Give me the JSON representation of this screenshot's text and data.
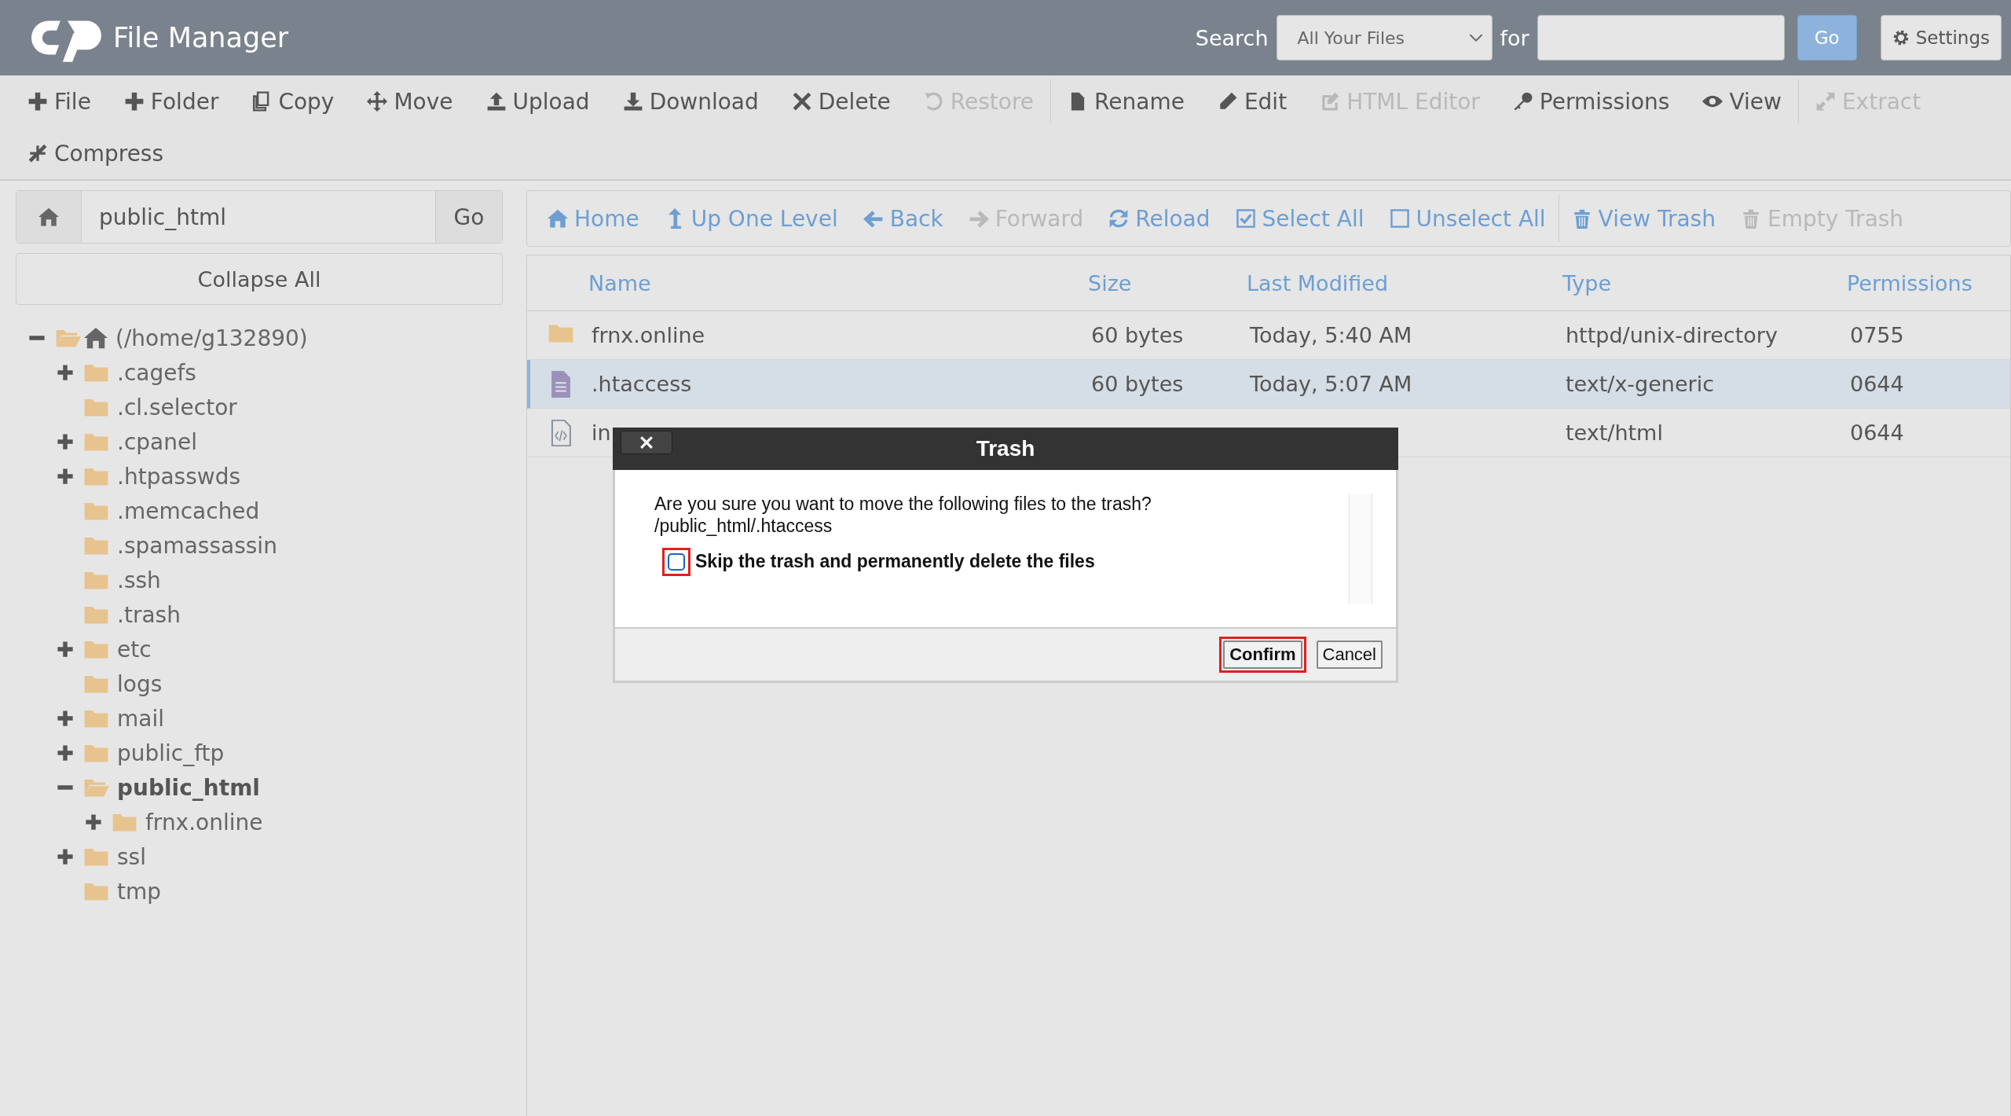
{
  "header": {
    "title": "File Manager",
    "search_label": "Search",
    "search_scope": "All Your Files",
    "for_label": "for",
    "go": "Go",
    "settings": "Settings"
  },
  "toolbar": [
    {
      "label": "File",
      "disabled": false
    },
    {
      "label": "Folder",
      "disabled": false
    },
    {
      "label": "Copy",
      "disabled": false
    },
    {
      "label": "Move",
      "disabled": false
    },
    {
      "label": "Upload",
      "disabled": false
    },
    {
      "label": "Download",
      "disabled": false
    },
    {
      "label": "Delete",
      "disabled": false
    },
    {
      "label": "Restore",
      "disabled": true
    },
    {
      "label": "Rename",
      "disabled": false
    },
    {
      "label": "Edit",
      "disabled": false
    },
    {
      "label": "HTML Editor",
      "disabled": true
    },
    {
      "label": "Permissions",
      "disabled": false
    },
    {
      "label": "View",
      "disabled": false
    },
    {
      "label": "Extract",
      "disabled": true
    },
    {
      "label": "Compress",
      "disabled": false
    }
  ],
  "path_bar": {
    "value": "public_html",
    "go": "Go"
  },
  "collapse_all": "Collapse All",
  "tree": [
    {
      "label": "(/home/g132890)",
      "kind": "root",
      "expanded": true,
      "selected": false,
      "children": [
        {
          "label": ".cagefs",
          "kind": "toggle",
          "expanded": false,
          "selected": false
        },
        {
          "label": ".cl.selector",
          "kind": "leaf",
          "selected": false
        },
        {
          "label": ".cpanel",
          "kind": "toggle",
          "expanded": false,
          "selected": false
        },
        {
          "label": ".htpasswds",
          "kind": "toggle",
          "expanded": false,
          "selected": false
        },
        {
          "label": ".memcached",
          "kind": "leaf",
          "selected": false
        },
        {
          "label": ".spamassassin",
          "kind": "leaf",
          "selected": false
        },
        {
          "label": ".ssh",
          "kind": "leaf",
          "selected": false
        },
        {
          "label": ".trash",
          "kind": "leaf",
          "selected": false
        },
        {
          "label": "etc",
          "kind": "toggle",
          "expanded": false,
          "selected": false
        },
        {
          "label": "logs",
          "kind": "leaf",
          "selected": false
        },
        {
          "label": "mail",
          "kind": "toggle",
          "expanded": false,
          "selected": false
        },
        {
          "label": "public_ftp",
          "kind": "toggle",
          "expanded": false,
          "selected": false
        },
        {
          "label": "public_html",
          "kind": "toggle",
          "expanded": true,
          "selected": true,
          "children": [
            {
              "label": "frnx.online",
              "kind": "toggle",
              "expanded": false,
              "selected": false
            }
          ]
        },
        {
          "label": "ssl",
          "kind": "toggle",
          "expanded": false,
          "selected": false
        },
        {
          "label": "tmp",
          "kind": "leaf",
          "selected": false
        }
      ]
    }
  ],
  "nav": [
    {
      "label": "Home",
      "disabled": false
    },
    {
      "label": "Up One Level",
      "disabled": false
    },
    {
      "label": "Back",
      "disabled": false
    },
    {
      "label": "Forward",
      "disabled": true
    },
    {
      "label": "Reload",
      "disabled": false
    },
    {
      "label": "Select All",
      "disabled": false
    },
    {
      "label": "Unselect All",
      "disabled": false
    },
    {
      "label": "View Trash",
      "disabled": false
    },
    {
      "label": "Empty Trash",
      "disabled": true
    }
  ],
  "table": {
    "columns": [
      "Name",
      "Size",
      "Last Modified",
      "Type",
      "Permissions"
    ],
    "rows": [
      {
        "kind": "folder",
        "selected": false,
        "cells": [
          "frnx.online",
          "60 bytes",
          "Today, 5:40 AM",
          "httpd/unix-directory",
          "0755"
        ]
      },
      {
        "kind": "text",
        "selected": true,
        "cells": [
          ".htaccess",
          "60 bytes",
          "Today, 5:07 AM",
          "text/x-generic",
          "0644"
        ]
      },
      {
        "kind": "code",
        "selected": false,
        "cells": [
          "in",
          "",
          "",
          "text/html",
          "0644"
        ]
      }
    ]
  },
  "dialog": {
    "title": "Trash",
    "message": "Are you sure you want to move the following files to the trash?",
    "path": "/public_html/.htaccess",
    "checkbox": {
      "label": "Skip the trash and permanently delete the files",
      "checked": false,
      "highlighted": true
    },
    "buttons": [
      {
        "label": "Confirm",
        "highlighted": true
      },
      {
        "label": "Cancel",
        "highlighted": false
      }
    ]
  }
}
